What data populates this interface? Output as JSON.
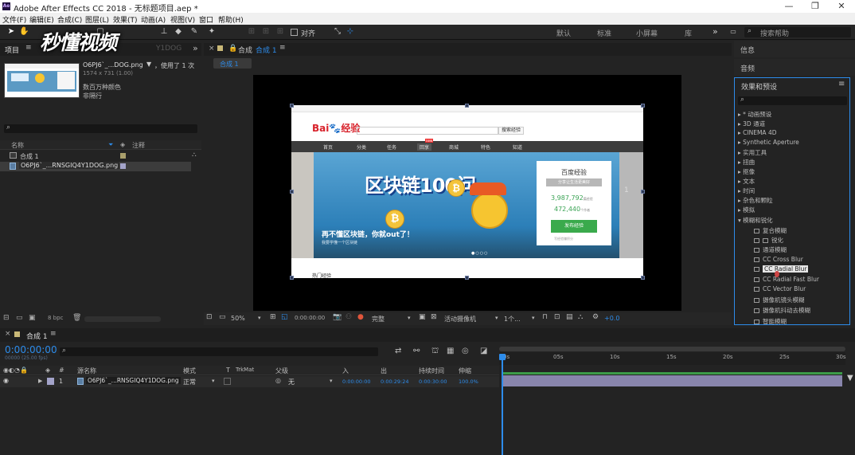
{
  "window": {
    "app_badge": "Ae",
    "title": "Adobe After Effects CC 2018 - 无标题项目.aep *",
    "controls": [
      "—",
      "❐",
      "✕"
    ]
  },
  "menu": [
    "文件(F)",
    "编辑(E)",
    "合成(C)",
    "图层(L)",
    "效果(T)",
    "动画(A)",
    "视图(V)",
    "窗口",
    "帮助(H)"
  ],
  "toolbar": {
    "align_label": "对齐",
    "workspaces": [
      "默认",
      "标准",
      "小屏幕",
      "库"
    ],
    "more": "»",
    "search_placeholder": "搜索帮助"
  },
  "watermark": "秒懂视频",
  "project": {
    "tab": "项目",
    "asset_name": "O6PJ6`_...DOG.png",
    "asset_used": "，使用了 1 次",
    "asset_dims": "1574 x 731 (1.00)",
    "asset_color": "数百万种颜色",
    "asset_scan": "非隔行",
    "col_name": "名称",
    "col_comment": "注释",
    "items": [
      "合成 1",
      "O6PJ6`_...RNSGIQ4Y1DOG.png"
    ],
    "bpc": "8 bpc",
    "ghost_tab": "Y1DOG"
  },
  "comp_viewer": {
    "tab_prefix": "合成",
    "tab_name": "合成 1",
    "sub_tab": "合成 1",
    "zoom": "50%",
    "timecode": "0:00:00:00",
    "quality": "完整",
    "camera": "活动摄像机",
    "views": "1个...",
    "exposure": "+0.0"
  },
  "screen": {
    "logo": "Bai",
    "logo_paw": "🐾",
    "logo_suffix": "经验",
    "search_btn": "搜索经验",
    "nav": [
      "首页",
      "分类",
      "任务",
      "回享",
      "商城",
      "特色",
      "知道"
    ],
    "nav_badge": "new",
    "banner_title": "区块链100问",
    "banner_slogan": "再不懂区块链，你就out了！",
    "banner_sub": "我要学懂一个区块链",
    "card_title": "百度经验",
    "card_tag": "分享让生活更美好",
    "card_count1": "3,987,792",
    "card_unit1": "篇经验",
    "card_count2": "472,440",
    "card_unit2": "个作者",
    "card_btn": "发布经验",
    "card_link": "写经验赚积分",
    "side_num": "1",
    "bottom_text": "热门经验"
  },
  "effects": {
    "info_tab": "信息",
    "audio_tab": "音频",
    "panel_title": "效果和预设",
    "search_placeholder": "",
    "categories": [
      "* 动画预设",
      "3D 通道",
      "CINEMA 4D",
      "Synthetic Aperture",
      "实用工具",
      "扭曲",
      "抠像",
      "文本",
      "时间",
      "杂色和颗粒",
      "模拟"
    ],
    "open_category": "模糊和锐化",
    "children": [
      "复合模糊",
      "锐化",
      "通道模糊",
      "CC Cross Blur",
      "CC Radial Blur",
      "CC Radial Fast Blur",
      "CC Vector Blur",
      "摄像机镜头模糊",
      "摄像机抖动去模糊",
      "智能模糊"
    ],
    "selected": "CC Radial Blur"
  },
  "timeline": {
    "tab": "合成 1",
    "timecode": "0:00:00:00",
    "fps": "00000 (25.00 fps)",
    "cols": {
      "num": "#",
      "source": "源名称",
      "mode": "模式",
      "t": "T",
      "trkmat": "TrkMat",
      "parent": "父级",
      "in": "入",
      "out": "出",
      "duration": "持续时间",
      "stretch": "伸缩"
    },
    "layer": {
      "index": "1",
      "name": "O6PJ6`_...RNSGIQ4Y1DOG.png",
      "mode": "正常",
      "parent": "无",
      "in": "0:00:00:00",
      "out": "0:00:29:24",
      "duration": "0:00:30:00",
      "stretch": "100.0%"
    },
    "ruler": [
      "0s",
      "05s",
      "10s",
      "15s",
      "20s",
      "25s",
      "30s"
    ]
  }
}
